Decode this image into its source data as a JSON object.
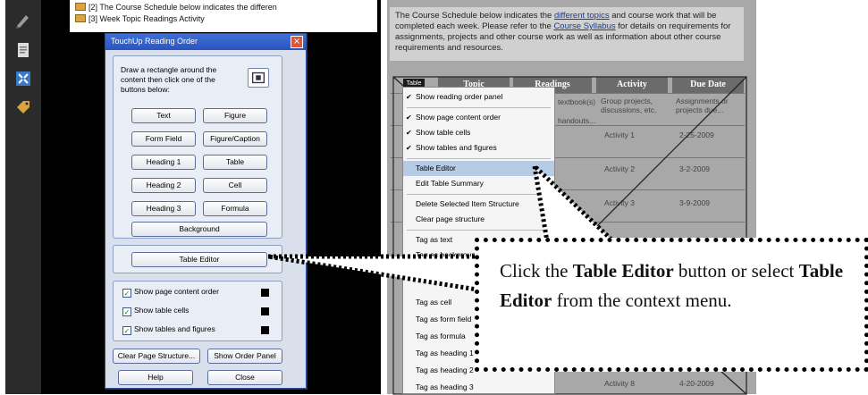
{
  "tree": {
    "line1": "[2]  The Course Schedule below indicates the differen",
    "line2": "[3]  Week Topic Readings Activity"
  },
  "dialog": {
    "title": "TouchUp Reading Order",
    "close": "×",
    "instructions": "Draw a rectangle around the content then click one of the buttons below:",
    "buttons": {
      "text": "Text",
      "figure": "Figure",
      "form_field": "Form Field",
      "figure_caption": "Figure/Caption",
      "heading1": "Heading 1",
      "table": "Table",
      "heading2": "Heading 2",
      "cell": "Cell",
      "heading3": "Heading 3",
      "formula": "Formula",
      "background": "Background",
      "table_editor": "Table Editor",
      "clear_page": "Clear Page Structure...",
      "show_order_panel": "Show Order Panel",
      "help": "Help",
      "close": "Close"
    },
    "checks": {
      "page_order": "Show page content order",
      "table_cells": "Show table cells",
      "tables_figures": "Show tables and figures"
    }
  },
  "document": {
    "index": "2",
    "para_part1": "The Course Schedule below indicates the ",
    "para_link1": "different topics",
    "para_part2": " and course work that will be completed each week.  Please refer to the ",
    "para_link2": "Course Syllabus",
    "para_part3": " for details on requirements for assignments, projects and other course work as well as information about other course requirements and resources.",
    "headers": [
      "Topic",
      "Readings",
      "Activity",
      "Due Date"
    ],
    "badge": "Table",
    "cells": {
      "readings_r1a": "textbook(s)",
      "readings_r1b": "handouts...",
      "activity_r1": "Group projects, discussions, etc.",
      "due_r1": "Assignments or projects due...",
      "activity_2": "Activity 1",
      "due_2": "2-25-2009",
      "activity_3": "Activity 2",
      "due_3": "3-2-2009",
      "activity_4": "Activity 3",
      "due_4": "3-9-2009",
      "activity_last": "Activity 8",
      "due_last": "4-20-2009"
    }
  },
  "context_menu": {
    "items": [
      {
        "label": "Show reading order panel",
        "checked": true
      },
      {
        "label": "Show page content order",
        "checked": true
      },
      {
        "label": "Show table cells",
        "checked": true
      },
      {
        "label": "Show tables and figures",
        "checked": true
      },
      {
        "label": "Table Editor",
        "selected": true
      },
      {
        "label": "Edit Table Summary"
      },
      {
        "label": "Delete Selected Item Structure"
      },
      {
        "label": "Clear page structure"
      },
      {
        "label": "Tag as text"
      },
      {
        "label": "Tag as background"
      },
      {
        "label": "Tag as cell"
      },
      {
        "label": "Tag as form field"
      },
      {
        "label": "Tag as formula"
      },
      {
        "label": "Tag as heading 1"
      },
      {
        "label": "Tag as heading 2"
      },
      {
        "label": "Tag as heading 3"
      }
    ]
  },
  "callout": {
    "p1": "Click the ",
    "b1": "Table Editor",
    "p2": " button or select ",
    "b2": "Table Editor",
    "p3": " from the context menu."
  }
}
